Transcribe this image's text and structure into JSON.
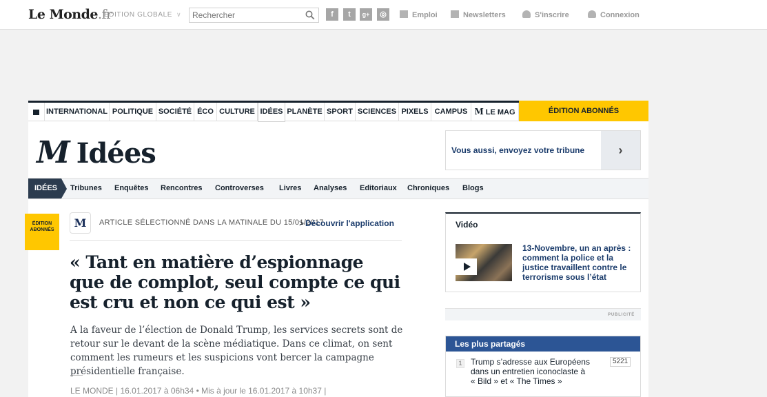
{
  "header": {
    "logo": "Le Monde",
    "logo_suffix": ".fr",
    "edition": "ÉDITION GLOBALE",
    "search_placeholder": "Rechercher",
    "social": [
      "f",
      "t",
      "g+",
      "◎"
    ],
    "links": {
      "emploi": "Emploi",
      "newsletters": "Newsletters",
      "inscrire": "S'inscrire",
      "connexion": "Connexion"
    }
  },
  "nav": {
    "items": [
      "INTERNATIONAL",
      "POLITIQUE",
      "SOCIÉTÉ",
      "ÉCO",
      "CULTURE",
      "IDÉES",
      "PLANÈTE",
      "SPORT",
      "SCIENCES",
      "PIXELS",
      "CAMPUS",
      "LE MAG"
    ],
    "active": "IDÉES",
    "mag_logo": "M",
    "abonnes": "ÉDITION ABONNÉS"
  },
  "section": {
    "logo": "M",
    "title": "Idées",
    "tribune": "Vous aussi, envoyez votre tribune",
    "tribune_arrow": "›"
  },
  "subnav": {
    "tag": "IDÉES",
    "items": [
      "Tribunes",
      "Enquêtes",
      "Rencontres",
      "Controverses",
      "Livres",
      "Analyses",
      "Editoriaux",
      "Chroniques",
      "Blogs"
    ]
  },
  "article": {
    "badge_line1": "ÉDITION",
    "badge_line2": "ABONNÉS",
    "app_icon": "M",
    "matinale": "ARTICLE SÉLECTIONNÉ DANS LA MATINALE DU 15/01/2017",
    "discover": "Découvrir l'application",
    "title": "« Tant en matière d’espionnage que de complot, seul compte ce qui est cru et non ce qui est »",
    "chapo": "A la faveur de l’élection de Donald Trump, les services secrets sont de retour sur le devant de la scène médiatique. Dans ce climat, on sent comment les rumeurs et les suspicions vont bercer la campagne présidentielle française.",
    "meta": "LE MONDE | 16.01.2017 à 06h34 • Mis à jour le 16.01.2017 à 10h37 |"
  },
  "sidebar": {
    "video_header": "Vidéo",
    "video_title": "13-Novembre, un an après : comment la police et la justice travaillent contre le terrorisme sous l’état",
    "publicite": "PUBLICITÉ",
    "shared_header": "Les plus partagés",
    "shared_items": [
      {
        "rank": "1",
        "title": "Trump s’adresse aux Européens dans un entretien iconoclaste à « Bild » et « The Times »",
        "count": "5221"
      }
    ]
  }
}
